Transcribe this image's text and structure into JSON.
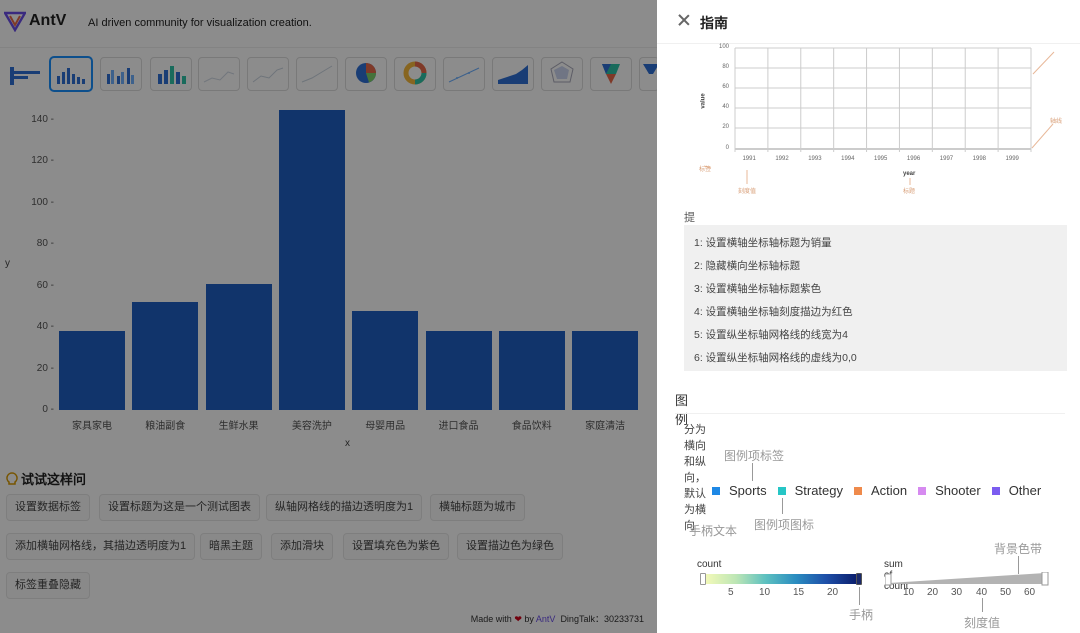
{
  "header": {
    "brand": "AntV",
    "tagline": "AI driven community for visualization creation."
  },
  "chart": {
    "ylabel": "y",
    "xlabel": "x",
    "yticks": [
      "140 -",
      "120 -",
      "100 -",
      "80 -",
      "60 -",
      "40 -",
      "20 -",
      "0 -"
    ]
  },
  "chart_data": {
    "type": "bar",
    "categories": [
      "家具家电",
      "粮油副食",
      "生鲜水果",
      "美容洗护",
      "母婴用品",
      "进口食品",
      "食品饮料",
      "家庭清洁"
    ],
    "values": [
      38,
      52,
      61,
      145,
      48,
      38,
      38,
      38
    ],
    "xlabel": "x",
    "ylabel": "y",
    "ylim": [
      0,
      150
    ],
    "color": "#1f5fc4",
    "grid": false
  },
  "try_section": {
    "title": "试试这样问",
    "chips": [
      "设置数据标签",
      "设置标题为这是一个测试图表",
      "纵轴网格线的描边透明度为1",
      "横轴标题为城市",
      "添加横轴网格线，其描边透明度为1",
      "暗黑主题",
      "添加滑块",
      "设置填充色为紫色",
      "设置描边色为绿色",
      "标签重叠隐藏"
    ]
  },
  "footer": {
    "made_with": "Made with",
    "by": "by",
    "antv": "AntV",
    "dingtalk": "DingTalk：30233731"
  },
  "drawer": {
    "title": "指南",
    "axis_diagram": {
      "y_ticks": [
        "100",
        "80",
        "60",
        "40",
        "20",
        "0"
      ],
      "x_ticks": [
        "1991",
        "1992",
        "1993",
        "1994",
        "1995",
        "1996",
        "1997",
        "1998",
        "1999"
      ],
      "ylabel": "value",
      "xlabel": "year",
      "annotations": {
        "axis_line": "轴线",
        "label": "标签",
        "tick_value": "刻度值",
        "title": "标题"
      }
    },
    "tips_title": "提问技巧",
    "tips": [
      "1: 设置横轴坐标轴标题为销量",
      "2: 隐藏横向坐标轴标题",
      "3: 设置横轴坐标轴标题紫色",
      "4: 设置横轴坐标轴刻度描边为红色",
      "5: 设置纵坐标轴网格线的线宽为4",
      "6: 设置纵坐标轴网格线的虚线为0,0"
    ],
    "legend_title": "图例",
    "legend_desc": "分为横向和纵向，默认为横向",
    "legend_annotations": {
      "item_label": "图例项标签",
      "item_icon": "图例项图标",
      "handle_text": "手柄文本",
      "handle": "手柄",
      "background_band": "背景色带",
      "tick_value": "刻度值"
    },
    "legend_items": [
      {
        "label": "Sports",
        "color": "#1e88e5"
      },
      {
        "label": "Strategy",
        "color": "#26c6c6"
      },
      {
        "label": "Action",
        "color": "#ef8a4b"
      },
      {
        "label": "Shooter",
        "color": "#d68af0"
      },
      {
        "label": "Other",
        "color": "#7b5cf0"
      }
    ],
    "continuous_legend": {
      "label": "count",
      "ticks": [
        "5",
        "10",
        "15",
        "20"
      ]
    },
    "size_legend": {
      "label": "sum of count",
      "ticks": [
        "10",
        "20",
        "30",
        "40",
        "50",
        "60"
      ]
    }
  }
}
